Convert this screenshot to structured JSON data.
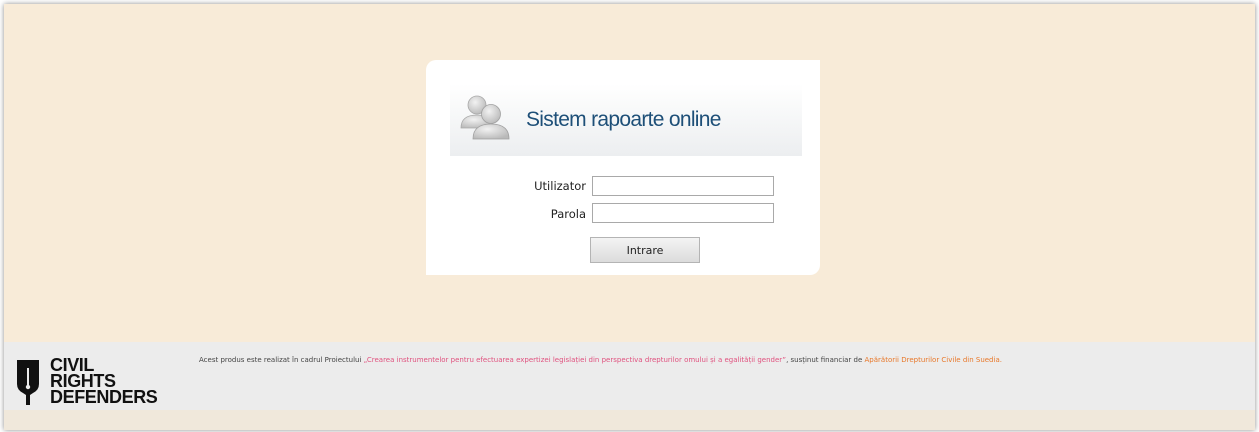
{
  "login": {
    "title": "Sistem rapoarte online",
    "icon": "users-icon",
    "username_label": "Utilizator",
    "username_value": "",
    "password_label": "Parola",
    "password_value": "",
    "submit_label": "Intrare"
  },
  "footer": {
    "logo": {
      "line1": "CIVIL",
      "line2": "RIGHTS",
      "line3": "DEFENDERS",
      "icon": "pen-nib-icon"
    },
    "text_prefix": "Acest produs este realizat în cadrul Proiectului ",
    "project_link": "„Crearea instrumentelor pentru efectuarea expertizei legislației din perspectiva drepturilor omului și a egalității gender”",
    "text_middle": ", susținut financiar de ",
    "sponsor_link": "Apărătorii Drepturilor Civile din Suedia",
    "text_suffix": "."
  },
  "colors": {
    "page_background": "#f8ebd8",
    "title_color": "#1e4f78",
    "project_link_color": "#e0527f",
    "sponsor_link_color": "#e8782a",
    "footer_background": "#ececec"
  }
}
